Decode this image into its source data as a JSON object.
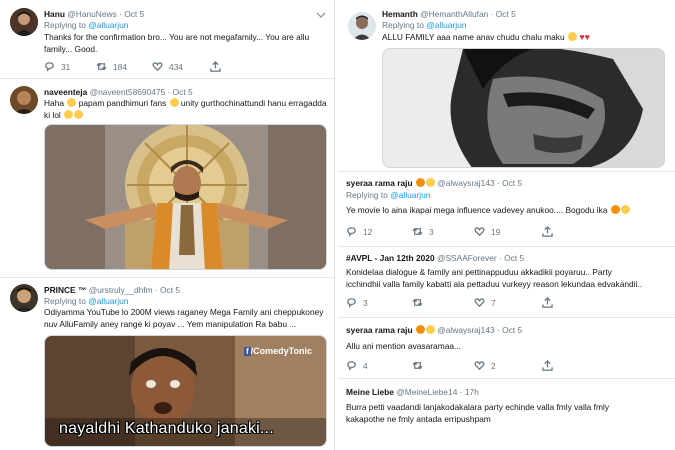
{
  "colors": {
    "link": "#1b95e0",
    "muted": "#657786",
    "text": "#14171a",
    "heart": "#dd2e44"
  },
  "left": {
    "t1": {
      "name": "Hanu",
      "handle": "@HanuNews",
      "dot": "·",
      "date": "Oct 5",
      "reply_prefix": "Replying to",
      "mention": "@alluarjun",
      "text": [
        "Thanks for the confirmation bro... You are not megafamily... You are allu",
        "family... Good."
      ],
      "replies": "31",
      "retweets": "184",
      "likes": "434"
    },
    "t2": {
      "name": "naveenteja",
      "handle": "@naveent58690475",
      "dot": "·",
      "date": "Oct 5",
      "text": [
        "Haha",
        "papam pandhimuri fans",
        "unity gurthochinattundi hanu erragadda",
        "ki lol"
      ]
    },
    "t3": {
      "name": "PRINCE ™",
      "handle": "@urstruly__dhfm",
      "dot": "·",
      "date": "Oct 5",
      "reply_prefix": "Replying to",
      "mention": "@alluarjun",
      "text": [
        "Odiyamma YouTube lo 200M views raganey Mega Family ani cheppukoney",
        "nuv AlluFamily aney range ki poyav ... Yem manipulation Ra babu ..."
      ],
      "image_brand": "/ComedyTonic",
      "image_caption": "nayaldhi Kathanduko janaki..."
    }
  },
  "right": {
    "t1": {
      "name": "Hemanth",
      "handle": "@HemanthAllufan",
      "dot": "·",
      "date": "Oct 5",
      "reply_prefix": "Replying to",
      "mention": "@alluarjun",
      "text": "ALLU FAMILY aaa name anav chudu chalu maku"
    },
    "t2": {
      "name": "syeraa rama raju",
      "handle": "@alwaysraj143",
      "dot": "·",
      "date": "Oct 5",
      "reply_prefix": "Replying to",
      "mention": "@alluarjun",
      "text": "Ye movie lo aina ikapai mega influence vadevey anukoo.... Bogodu ika",
      "replies": "12",
      "retweets": "3",
      "likes": "19"
    },
    "t3": {
      "name": "#AVPL - Jan 12th 2020",
      "handle": "@SSAAForever",
      "dot": "·",
      "date": "Oct 5",
      "text": [
        "Konidelaa dialogue & family ani pettinappuduu akkadikii poyaruu.. Party",
        "icchindhii valla family kabatti ala pettaduu vurkeyy reason lekundaa edvakandii.."
      ],
      "replies": "3",
      "likes": "7"
    },
    "t4": {
      "name": "syeraa rama raju",
      "handle": "@alwaysraj143",
      "dot": "·",
      "date": "Oct 5",
      "text": "Allu ani mention avasaramaa...",
      "replies": "4",
      "likes": "2"
    },
    "t5": {
      "name": "Meine Liebe",
      "handle": "@MeineLiebe14",
      "dot": "·",
      "date": "17h",
      "text": [
        "Burra petti vaadandi lanjakodakalara party echinde valla fmly valla fmly",
        "kakapothe ne fmly antada erripushpam"
      ]
    }
  }
}
